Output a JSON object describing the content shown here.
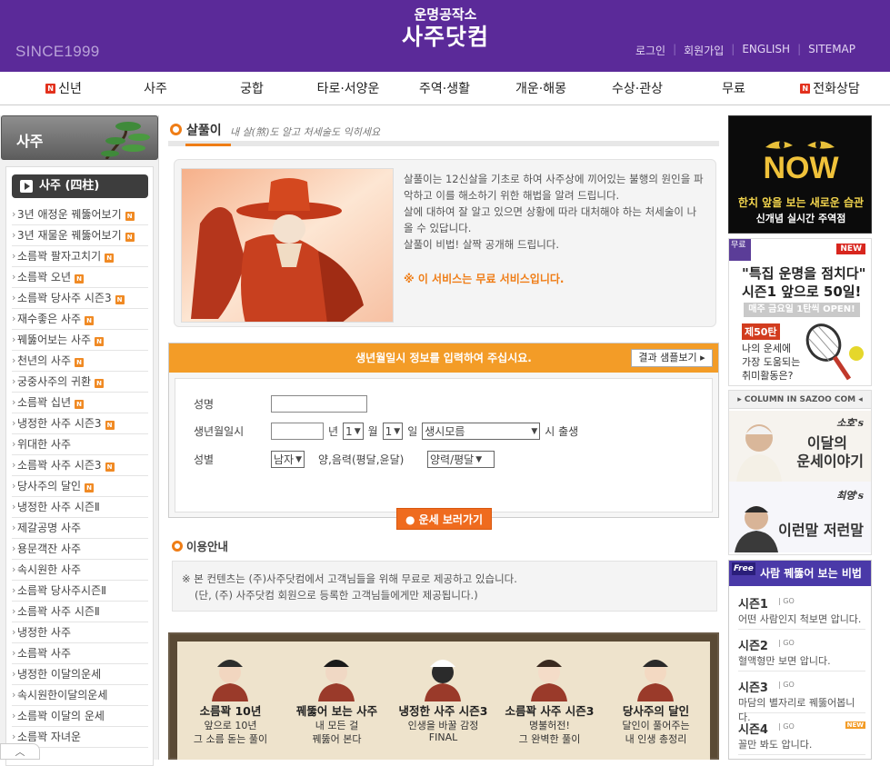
{
  "header": {
    "since": "SINCE1999",
    "logo_line1": "운명공작소",
    "logo_line2": "사주닷컴",
    "links": [
      "로그인",
      "회원가입",
      "ENGLISH",
      "SITEMAP"
    ]
  },
  "gnb": [
    {
      "label": "신년",
      "badge": "N"
    },
    {
      "label": "사주"
    },
    {
      "label": "궁합"
    },
    {
      "label": "타로·서양운"
    },
    {
      "label": "주역·생활"
    },
    {
      "label": "개운·해몽"
    },
    {
      "label": "수상·관상"
    },
    {
      "label": "무료"
    },
    {
      "label": "전화상담",
      "badge": "N"
    }
  ],
  "sidebar": {
    "title": "사주",
    "subtitle": "사주 (四柱)",
    "items": [
      "3년 애정운 꿰뚫어보기",
      "3년 재물운 꿰뚫어보기",
      "소름꽉 팔자고치기",
      "소름꽉 오년",
      "소름꽉 당사주 시즌3",
      "재수좋은 사주",
      "꿰뚫어보는 사주",
      "천년의 사주",
      "궁중사주의 귀환",
      "소름꽉 십년",
      "냉정한 사주 시즌3",
      "위대한 사주",
      "소름꽉 사주 시즌3",
      "당사주의 달인",
      "냉정한 사주 시즌Ⅱ",
      "제갈공명 사주",
      "용문객잔 사주",
      "속시원한 사주",
      "소름꽉 당사주시즌Ⅱ",
      "소름꽉 사주 시즌Ⅱ",
      "냉정한 사주",
      "소름꽉 사주",
      "냉정한 이달의운세",
      "속시원한이달의운세",
      "소름꽉 이달의 운세",
      "소름꽉 자녀운"
    ],
    "badged": [
      0,
      1,
      2,
      3,
      4,
      5,
      6,
      7,
      8,
      9,
      10,
      12,
      13
    ],
    "badge_label": "N"
  },
  "main": {
    "title": "살풀이",
    "subtitle": "내 살(煞)도 알고 처세술도 익히세요",
    "intro": [
      "살풀이는 12신살을 기초로 하여 사주상에 끼어있는 불행의 원인을 파악하고 이를 해소하기 위한 해법을 알려 드립니다.",
      "살에 대하여 잘 알고 있으면 상황에 따라 대처해야 하는 처세술이 나올 수 있답니다.",
      "살풀이 비법! 살짝 공개해 드립니다."
    ],
    "free_notice": "※ 이 서비스는 무료 서비스입니다.",
    "form": {
      "bar_text": "생년월일시 정보를 입력하여 주십시요.",
      "sample_button": "결과 샘플보기 ▸",
      "name_label": "성명",
      "birth_label": "생년월일시",
      "year_unit": "년",
      "month_value": "1",
      "month_unit": "월",
      "day_value": "1",
      "day_unit": "일",
      "hour_value": "생시모름",
      "hour_unit": "시 출생",
      "gender_label": "성별",
      "gender_value": "남자",
      "calendar_label": "양,음력(평달,윤달)",
      "calendar_value": "양력/평달"
    },
    "go_button": "● 운세 보러가기",
    "info_title": "이용안내",
    "info_lines": [
      "※ 본 컨텐츠는 (주)사주닷컴에서 고객님들을 위해 무료로 제공하고 있습니다.",
      "(단, (주) 사주닷컴 회원으로 등록한 고객님들에게만 제공됩니다.)"
    ],
    "banner": [
      {
        "title": "소름꽉 10년",
        "l1": "앞으로 10년",
        "l2": "그 소름 돋는 풀이"
      },
      {
        "title": "꿰뚫어 보는 사주",
        "l1": "내 모든 걸",
        "l2": "꿰뚫어 본다"
      },
      {
        "title": "냉정한 사주 시즌3",
        "l1": "인생을 바꿀 감정",
        "l2": "FINAL"
      },
      {
        "title": "소름꽉 사주 시즌3",
        "l1": "명불허전!",
        "l2": "그 완벽한 풀이"
      },
      {
        "title": "당사주의 달인",
        "l1": "달인이 풀어주는",
        "l2": "내 인생 총정리"
      }
    ]
  },
  "right": {
    "now": {
      "big": "NOW",
      "yellow": "한치 앞을 보는 새로운 습관",
      "white": "신개념 실시간 주역점"
    },
    "special": {
      "ribbon": "무료",
      "new": "NEW",
      "h1": "\"특집 운명을 점치다\"",
      "h2": "시즌1 앞으로 50일!",
      "bar": "매주 금요일 1탄씩 OPEN!",
      "ep": "제50탄",
      "d1": "나의 운세에",
      "d2": "가장 도움되는",
      "d3": "취미활동은?"
    },
    "column": {
      "header": "▸ COLUMN IN SAZOO COM ◂",
      "c1_tag": "소호's",
      "c1_a": "이달의",
      "c1_b": "운세이야기",
      "c2_tag": "최영's",
      "c2_a": "이런말 저런말"
    },
    "bibeop": {
      "free": "Free",
      "title": "사람 꿰뚫어 보는 비법",
      "items": [
        {
          "n": "시즌1",
          "go": "| GO",
          "d": "어떤 사람인지 척보면 압니다."
        },
        {
          "n": "시즌2",
          "go": "| GO",
          "d": "혈액형만 보면 압니다."
        },
        {
          "n": "시즌3",
          "go": "| GO",
          "d": "마담의 별자리로 꿰뚫어봅니다."
        },
        {
          "n": "시즌4",
          "go": "| GO",
          "d": "꼴만 봐도 압니다.",
          "new": "NEW"
        }
      ]
    }
  },
  "colors": {
    "purple": "#5b2a99",
    "orange": "#ef7d16",
    "badge_red": "#e2311d"
  }
}
